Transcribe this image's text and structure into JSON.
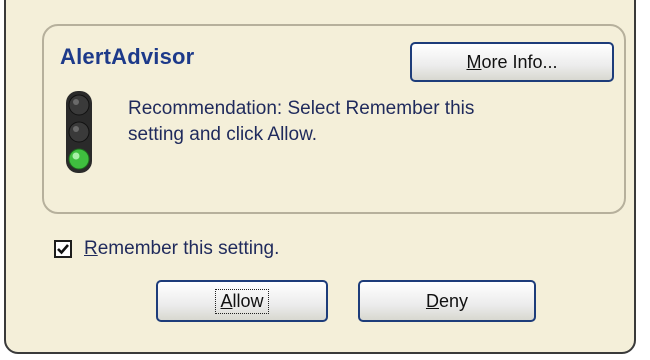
{
  "advisor": {
    "title": "AlertAdvisor",
    "more_info_prefix": "",
    "more_info_mnemonic": "M",
    "more_info_rest": "ore Info...",
    "recommendation_line1": "Recommendation: Select Remember this",
    "recommendation_line2": "setting and click Allow.",
    "traffic_light_state": "green",
    "colors": {
      "title": "#1d3a8a",
      "green_lamp": "#3fbf3f"
    }
  },
  "remember": {
    "checked": true,
    "label_mnemonic": "R",
    "label_rest": "emember this setting."
  },
  "buttons": {
    "allow_mnemonic": "A",
    "allow_rest": "llow",
    "deny_mnemonic": "D",
    "deny_rest": "eny"
  }
}
